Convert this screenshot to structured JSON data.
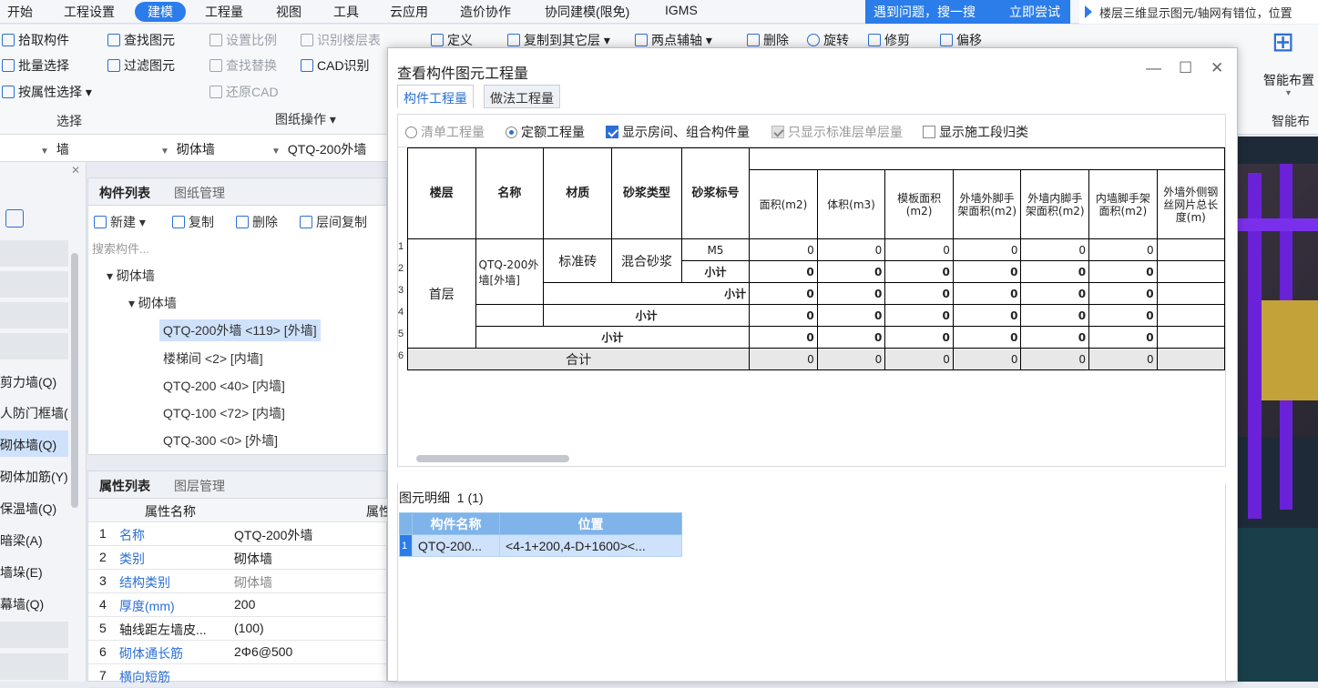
{
  "menu": [
    "开始",
    "工程设置",
    "建模",
    "工程量",
    "视图",
    "工具",
    "云应用",
    "造价协作",
    "协同建模(限免)",
    "IGMS"
  ],
  "tip": {
    "text": "遇到问题，搜一搜",
    "action": "立即尝试"
  },
  "notice": "楼层三维显示图元/轴网有错位，位置",
  "ribbon": {
    "select_group": {
      "pick": "拾取构件",
      "batch": "批量选择",
      "by_attr": "按属性选择",
      "label": "选择"
    },
    "find": {
      "find": "查找图元",
      "filter": "过滤图元"
    },
    "drawing": {
      "scale": "设置比例",
      "floor": "识别楼层表",
      "find_replace": "查找替换",
      "cad": "CAD识别",
      "restore": "还原CAD",
      "label": "图纸操作"
    },
    "modify": {
      "define": "定义",
      "copy_to": "复制到其它层",
      "aux": "两点辅轴",
      "delete": "删除",
      "rotate": "旋转",
      "trim": "修剪",
      "offset": "偏移"
    },
    "smart": {
      "label1": "智能布置",
      "label2": "智能布"
    }
  },
  "selector": {
    "a": "墙",
    "b": "砌体墙",
    "c": "QTQ-200外墙"
  },
  "leftnav": [
    "剪力墙(Q)",
    "人防门框墙(.",
    "砌体墙(Q)",
    "砌体加筋(Y)",
    "保温墙(Q)",
    "暗梁(A)",
    "墙垛(E)",
    "幕墙(Q)"
  ],
  "components": {
    "tabs": [
      "构件列表",
      "图纸管理"
    ],
    "toolbar": {
      "new": "新建",
      "copy": "复制",
      "delete": "删除",
      "floor_copy": "层间复制"
    },
    "search_placeholder": "搜索构件...",
    "tree": {
      "root": "砌体墙",
      "child": "砌体墙",
      "items": [
        "QTQ-200外墙 <119> [外墙]",
        "楼梯间 <2> [内墙]",
        "QTQ-200 <40> [内墙]",
        "QTQ-100 <72> [内墙]",
        "QTQ-300 <0> [外墙]"
      ]
    }
  },
  "properties": {
    "tabs": [
      "属性列表",
      "图层管理"
    ],
    "header": [
      "属性名称",
      "属性"
    ],
    "rows": [
      {
        "n": "1",
        "name": "名称",
        "value": "QTQ-200外墙"
      },
      {
        "n": "2",
        "name": "类别",
        "value": "砌体墙"
      },
      {
        "n": "3",
        "name": "结构类别",
        "value": "砌体墙"
      },
      {
        "n": "4",
        "name": "厚度(mm)",
        "value": "200"
      },
      {
        "n": "5",
        "name": "轴线距左墙皮...",
        "value": "(100)"
      },
      {
        "n": "6",
        "name": "砌体通长筋",
        "value": "2Φ6@500"
      },
      {
        "n": "7",
        "name": "横向短筋",
        "value": ""
      }
    ]
  },
  "dialog": {
    "title": "查看构件图元工程量",
    "tabs": [
      "构件工程量",
      "做法工程量"
    ],
    "options": {
      "list_qty": "清单工程量",
      "quota_qty": "定额工程量",
      "show_rooms": "显示房间、组合构件量",
      "only_std": "只显示标准层单层量",
      "show_stage": "显示施工段归类"
    },
    "table": {
      "headers": {
        "floor": "楼层",
        "name": "名称",
        "material": "材质",
        "mortar_type": "砂浆类型",
        "mortar_grade": "砂浆标号"
      },
      "qty_headers": [
        "面积(m2)",
        "体积(m3)",
        "模板面积(m2)",
        "外墙外脚手架面积(m2)",
        "外墙内脚手架面积(m2)",
        "内墙脚手架面积(m2)",
        "外墙外侧钢丝网片总长度(m)"
      ],
      "floor": "首层",
      "name": "QTQ-200外墙[外墙]",
      "material": "标准砖",
      "mortar_type": "混合砂浆",
      "mortar_grade": "M5",
      "subtotal": "小计",
      "total": "合计",
      "rows": [
        {
          "n": "1",
          "values": [
            "0",
            "0",
            "0",
            "0",
            "0",
            "0"
          ]
        },
        {
          "n": "2",
          "values": [
            "0",
            "0",
            "0",
            "0",
            "0",
            "0"
          ]
        },
        {
          "n": "3",
          "values": [
            "0",
            "0",
            "0",
            "0",
            "0",
            "0"
          ]
        },
        {
          "n": "4",
          "values": [
            "0",
            "0",
            "0",
            "0",
            "0",
            "0"
          ]
        },
        {
          "n": "5",
          "values": [
            "0",
            "0",
            "0",
            "0",
            "0",
            "0"
          ]
        },
        {
          "n": "6",
          "values": [
            "0",
            "0",
            "0",
            "0",
            "0",
            "0"
          ]
        }
      ]
    },
    "detail": {
      "label": "图元明细",
      "count": "1 (1)",
      "headers": [
        "构件名称",
        "位置"
      ],
      "row": {
        "n": "1",
        "name": "QTQ-200...",
        "pos": "<4-1+200,4-D+1600><..."
      }
    }
  },
  "colors": {
    "accent": "#2b7de9",
    "highlight": "#cfe2fb",
    "purple": "#6a22d8"
  }
}
